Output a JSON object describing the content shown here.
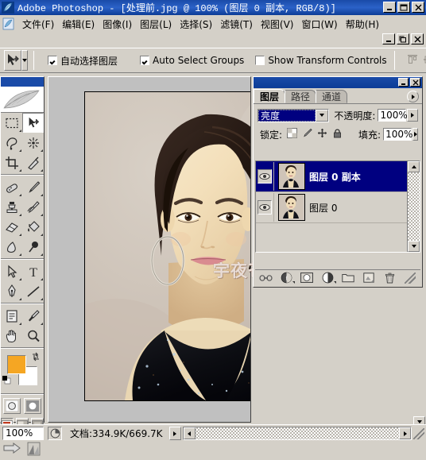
{
  "window": {
    "title": "Adobe Photoshop - [处理前.jpg @ 100% (图层 0 副本, RGB/8)]",
    "app_icon": "photoshop-feather-icon",
    "minimize": "_",
    "maximize": "□",
    "close": "✕",
    "doc_restore": "❐"
  },
  "menubar": {
    "items": [
      {
        "label": "文件(F)"
      },
      {
        "label": "编辑(E)"
      },
      {
        "label": "图像(I)"
      },
      {
        "label": "图层(L)"
      },
      {
        "label": "选择(S)"
      },
      {
        "label": "滤镜(T)"
      },
      {
        "label": "视图(V)"
      },
      {
        "label": "窗口(W)"
      },
      {
        "label": "帮助(H)"
      }
    ]
  },
  "options_bar": {
    "tool_icon": "move-tool-icon",
    "preset_dropdown": "▾",
    "checkboxes": [
      {
        "label": "自动选择图层",
        "checked": true
      },
      {
        "label": "Auto Select Groups",
        "checked": true
      },
      {
        "label": "Show Transform Controls",
        "checked": false
      }
    ],
    "align_icons": [
      "align-top-icon",
      "align-vertical-center-icon",
      "align-bottom-icon"
    ]
  },
  "toolbox": {
    "tools": [
      {
        "name": "rectangular-marquee-tool",
        "glyph": "marquee"
      },
      {
        "name": "move-tool",
        "glyph": "move",
        "selected": true
      },
      {
        "name": "lasso-tool",
        "glyph": "lasso"
      },
      {
        "name": "magic-wand-tool",
        "glyph": "wand"
      },
      {
        "name": "crop-tool",
        "glyph": "crop"
      },
      {
        "name": "slice-tool",
        "glyph": "slice"
      },
      {
        "name": "healing-brush-tool",
        "glyph": "heal"
      },
      {
        "name": "brush-tool",
        "glyph": "brush"
      },
      {
        "name": "clone-stamp-tool",
        "glyph": "stamp"
      },
      {
        "name": "history-brush-tool",
        "glyph": "historybrush"
      },
      {
        "name": "eraser-tool",
        "glyph": "eraser"
      },
      {
        "name": "gradient-tool",
        "glyph": "paintbucket"
      },
      {
        "name": "blur-tool",
        "glyph": "blur"
      },
      {
        "name": "dodge-tool",
        "glyph": "dodge"
      },
      {
        "name": "path-selection-tool",
        "glyph": "pathselect"
      },
      {
        "name": "type-tool",
        "glyph": "type"
      },
      {
        "name": "pen-tool",
        "glyph": "pen"
      },
      {
        "name": "line-tool",
        "glyph": "line"
      },
      {
        "name": "notes-tool",
        "glyph": "notes"
      },
      {
        "name": "eyedropper-tool",
        "glyph": "eyedropper"
      },
      {
        "name": "hand-tool",
        "glyph": "hand"
      },
      {
        "name": "zoom-tool",
        "glyph": "zoom"
      }
    ],
    "foreground_color": "#f5a623",
    "background_color": "#ffffff",
    "quickmask": [
      "standard-mode-icon",
      "quick-mask-mode-icon"
    ],
    "screenmode": [
      "standard-screen-icon",
      "full-screen-menubar-icon",
      "full-screen-icon"
    ],
    "jump": [
      "jump-to-imageready-icon"
    ]
  },
  "layers_palette": {
    "tabs": [
      {
        "label": "图层",
        "active": true
      },
      {
        "label": "路径",
        "active": false
      },
      {
        "label": "通道",
        "active": false
      }
    ],
    "menu_icon": "palette-menu-icon",
    "blend_mode": "亮度",
    "blend_dropdown_icon": "chevron-down-icon",
    "opacity_label": "不透明度:",
    "opacity_value": "100%",
    "lock_label": "锁定:",
    "lock_icons": [
      "lock-transparency-icon",
      "lock-image-pixels-icon",
      "lock-position-icon",
      "lock-all-icon"
    ],
    "fill_label": "填充:",
    "fill_value": "100%",
    "layers": [
      {
        "name": "图层 0 副本",
        "visible": true,
        "selected": true,
        "thumb": "portrait-thumbnail"
      },
      {
        "name": "图层 0",
        "visible": true,
        "selected": false,
        "thumb": "portrait-thumbnail"
      }
    ],
    "bottom_icons": [
      "link-layers-icon",
      "layer-style-fx-icon",
      "add-layer-mask-icon",
      "new-adjustment-layer-icon",
      "new-group-icon",
      "new-layer-icon",
      "delete-layer-icon"
    ]
  },
  "document": {
    "canvas_alt": "portrait-photo-of-woman-in-black-sequin-dress",
    "watermark": "宇夜苍穹出品"
  },
  "statusbar": {
    "zoom_value": "100%",
    "preview_icon": "document-preview-icon",
    "doc_info": "文档:334.9K/669.7K",
    "expand_icon": "right-triangle-icon"
  },
  "colors": {
    "titlebar_blue": "#1a4ba8",
    "selection_blue": "#000080",
    "chrome_gray": "#d4d0c8",
    "accent_orange": "#f5a623"
  }
}
